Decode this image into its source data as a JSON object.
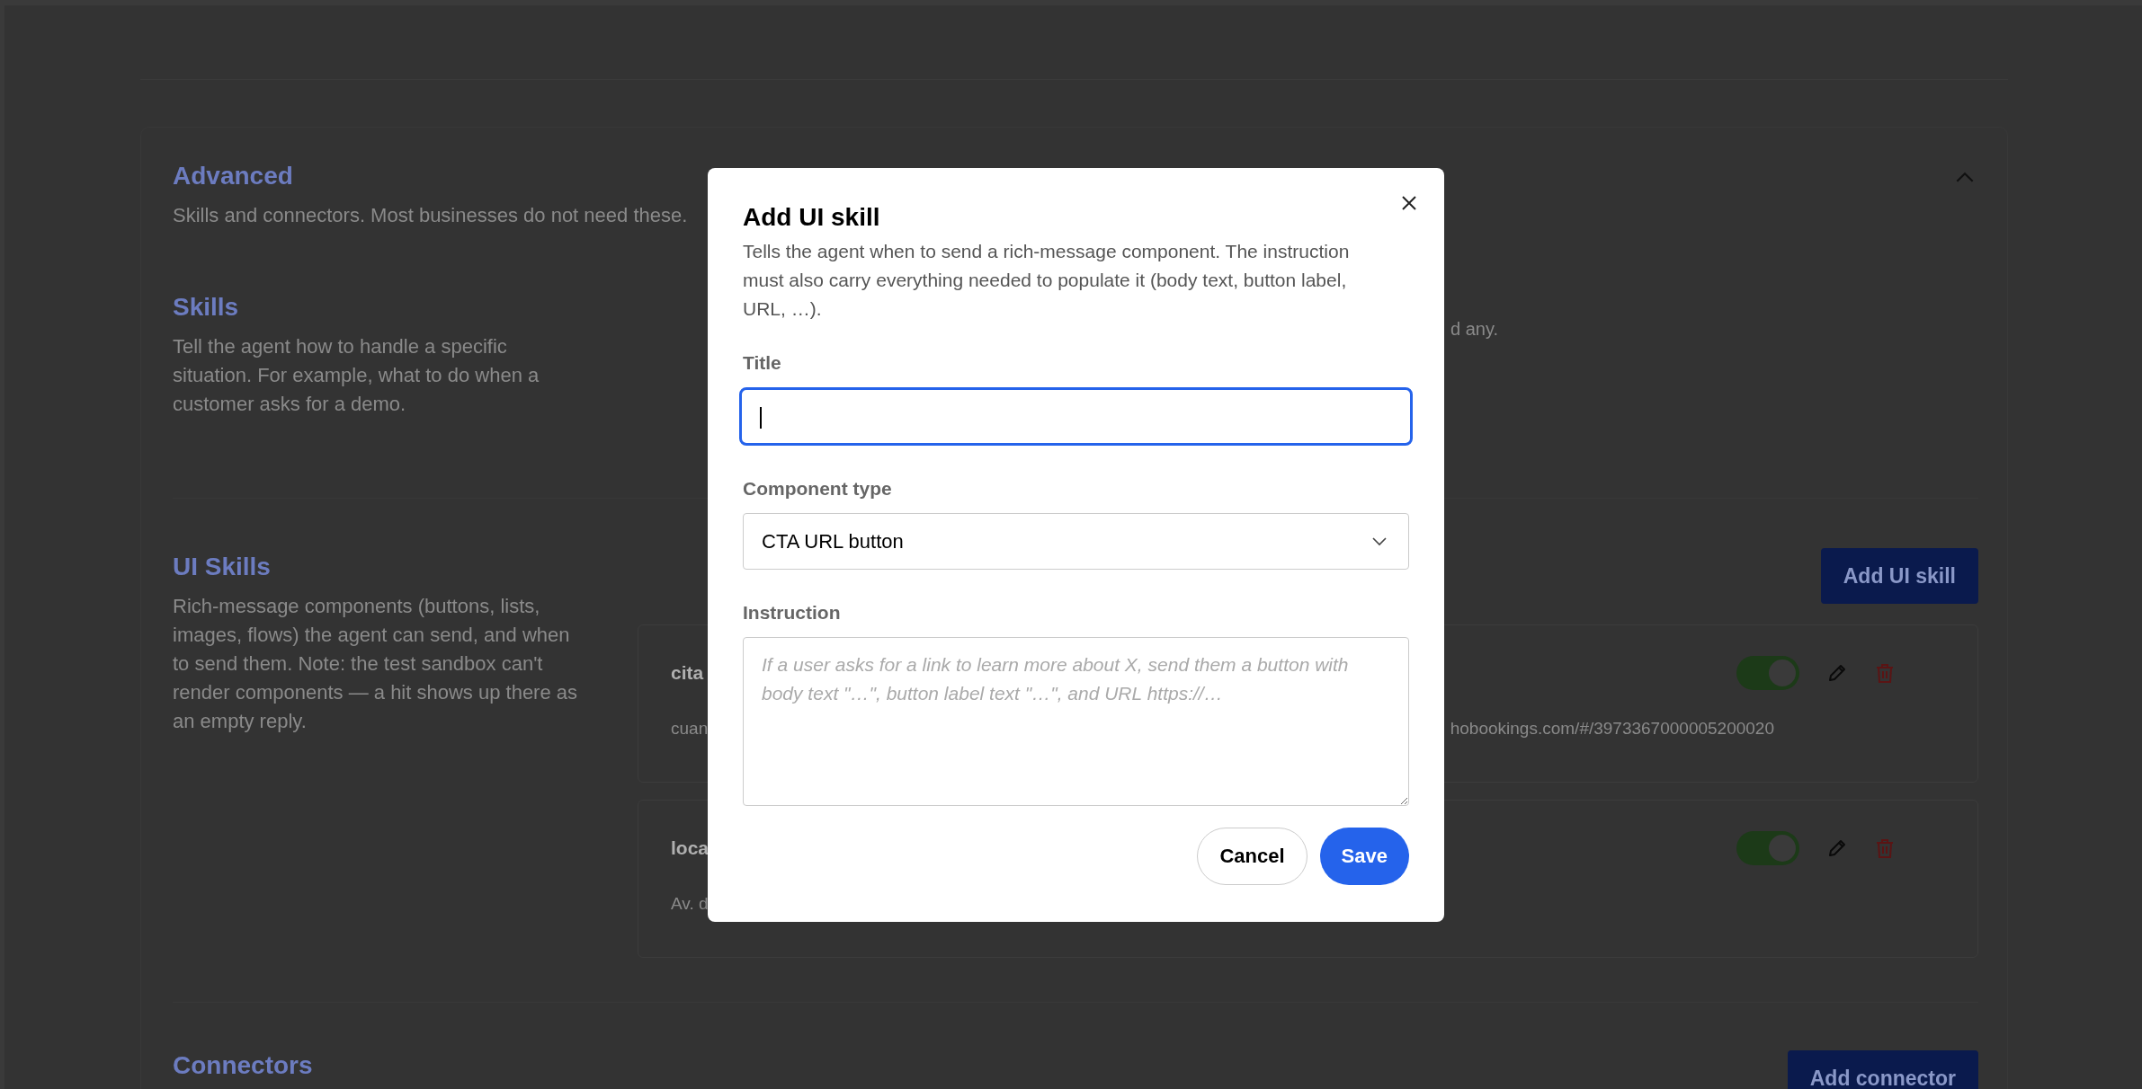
{
  "advanced": {
    "title": "Advanced",
    "description": "Skills and connectors. Most businesses do not need these.",
    "expanded": true
  },
  "skills": {
    "title": "Skills",
    "description": "Tell the agent how to handle a specific situation. For example, what to do when a customer asks for a demo.",
    "note_tail": "d any."
  },
  "ui_skills": {
    "title": "UI Skills",
    "description": "Rich-message components (buttons, lists, images, flows) the agent can send, and when to send them. Note: the test sandbox can't render components — a hit shows up there as an empty reply.",
    "add_button": "Add UI skill",
    "items": [
      {
        "title": "cita",
        "detail": "cuan",
        "detail_tail": "hobookings.com/#/3973367000005200020",
        "enabled": true
      },
      {
        "title": "loca",
        "detail": "Av. d",
        "enabled": true
      }
    ]
  },
  "connectors": {
    "title": "Connectors",
    "add_button": "Add connector"
  },
  "modal": {
    "title": "Add UI skill",
    "description": "Tells the agent when to send a rich-message component. The instruction must also carry everything needed to populate it (body text, button label, URL, …).",
    "fields": [
      {
        "kind": "text",
        "label": "Title",
        "focused": true
      },
      {
        "kind": "select",
        "label": "Component type",
        "value": "CTA URL button"
      },
      {
        "kind": "textarea",
        "label": "Instruction",
        "placeholder": "If a user asks for a link to learn more about X, send them a button with body text \"…\", button label text \"…\", and URL https://…"
      }
    ],
    "buttons": [
      {
        "label": "Cancel",
        "primary": false
      },
      {
        "label": "Save",
        "primary": true
      }
    ]
  }
}
